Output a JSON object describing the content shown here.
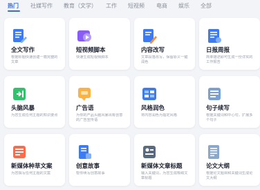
{
  "tabs": [
    {
      "label": "热门",
      "active": true
    },
    {
      "label": "社媒写作",
      "active": false
    },
    {
      "label": "教育（文学）",
      "active": false
    },
    {
      "label": "工作",
      "active": false
    },
    {
      "label": "短视频",
      "active": false
    },
    {
      "label": "电商",
      "active": false
    },
    {
      "label": "娱乐",
      "active": false
    },
    {
      "label": "全部",
      "active": false
    }
  ],
  "cards": [
    {
      "title": "全文写作",
      "desc": "根据标题快速创建一篇完整的文章",
      "icon": "document-edit-icon"
    },
    {
      "title": "短视频脚本",
      "desc": "快速生成短视频脚本",
      "icon": "video-play-icon"
    },
    {
      "title": "内容改写",
      "desc": "文章段落改写，保留原义一键润色",
      "icon": "rewrite-icon"
    },
    {
      "title": "日报周报",
      "desc": "简单描述即可生成一份详实的工作报告",
      "icon": "report-icon"
    },
    {
      "title": "头脑风暴",
      "desc": "为您生成任何主题的知识要点",
      "icon": "lightbulb-icon"
    },
    {
      "title": "广告语",
      "desc": "为你的产品头脑风暴出有创意的广告宣传语",
      "icon": "ad-icon"
    },
    {
      "title": "风格润色",
      "desc": "将内容润色为指定风格",
      "icon": "style-icon"
    },
    {
      "title": "句子续写",
      "desc": "根据关键词和中心句，扩展多个句子",
      "icon": "sentence-icon"
    },
    {
      "title": "新媒体种草文案",
      "desc": "为您撰写任何主题的文案",
      "icon": "media-post-icon"
    },
    {
      "title": "创意故事",
      "desc": "帮你续写创意故事",
      "icon": "story-book-icon"
    },
    {
      "title": "新媒体文章标题",
      "desc": "输入关键词，为您生成吸睛文章标题",
      "icon": "headline-icon"
    },
    {
      "title": "论文大纲",
      "desc": "根据论文题目和关键词生成论文大纲",
      "icon": "outline-icon"
    }
  ]
}
